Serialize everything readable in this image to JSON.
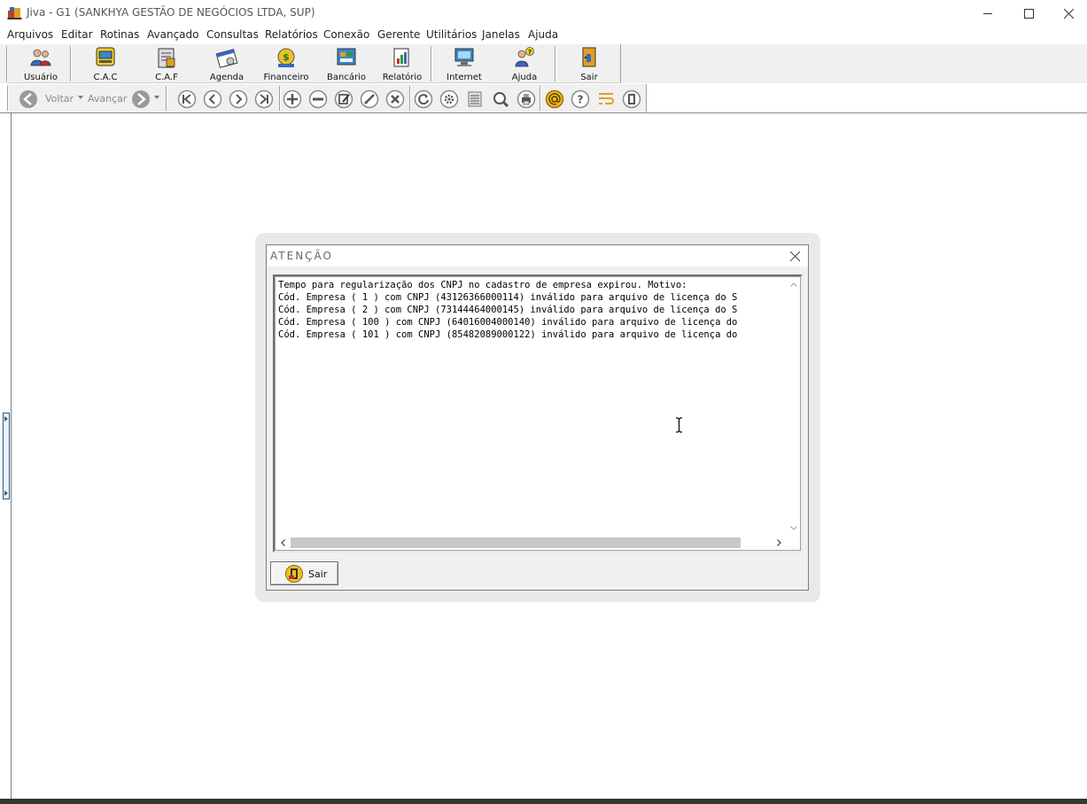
{
  "window": {
    "title": "Jiva - G1 (SANKHYA GESTÃO DE NEGÓCIOS LTDA, SUP)",
    "app_icon": "jiva-app-icon",
    "controls": [
      "minimize-icon",
      "maximize-icon",
      "close-icon"
    ]
  },
  "menu": {
    "items": [
      {
        "label": "Arquivos"
      },
      {
        "label": "Editar"
      },
      {
        "label": "Rotinas"
      },
      {
        "label": "Avançado"
      },
      {
        "label": "Consultas"
      },
      {
        "label": "Relatórios"
      },
      {
        "label": "Conexão"
      },
      {
        "label": "Gerente"
      },
      {
        "label": "Utilitários"
      },
      {
        "label": "Janelas"
      },
      {
        "label": "Ajuda"
      }
    ]
  },
  "toolbar": {
    "buttons": [
      {
        "label": "Usuário",
        "icon": "user-icon"
      },
      {
        "label": "C.A.C",
        "icon": "cac-register-icon"
      },
      {
        "label": "C.A.F",
        "icon": "caf-document-icon"
      },
      {
        "label": "Agenda",
        "icon": "agenda-icon"
      },
      {
        "label": "Financeiro",
        "icon": "finance-icon"
      },
      {
        "label": "Bancário",
        "icon": "bank-icon"
      },
      {
        "label": "Relatório",
        "icon": "report-icon"
      },
      {
        "label": "Internet",
        "icon": "internet-icon"
      },
      {
        "label": "Ajuda",
        "icon": "help-icon"
      },
      {
        "label": "Sair",
        "icon": "exit-icon"
      }
    ]
  },
  "nav_toolbar": {
    "back_label": "Voltar",
    "forward_label": "Avançar"
  },
  "dialog": {
    "title": "ATENÇÃO",
    "message_lines": [
      "Tempo para regularização dos CNPJ no cadastro de empresa expirou. Motivo:",
      "Cód. Empresa ( 1 ) com CNPJ (43126366000114) inválido para arquivo de licença do S",
      "Cód. Empresa ( 2 ) com CNPJ (73144464000145) inválido para arquivo de licença do S",
      "Cód. Empresa ( 100 ) com CNPJ (64016004000140) inválido para arquivo de licença do",
      "Cód. Empresa ( 101 ) com CNPJ (85482089000122) inválido para arquivo de licença do"
    ],
    "exit_button_label": "Sair"
  },
  "colors": {
    "toolbar_bg": "#f0f0f0",
    "dialog_bg": "#f0f0f0",
    "accent_blue": "#2c5a8a"
  }
}
